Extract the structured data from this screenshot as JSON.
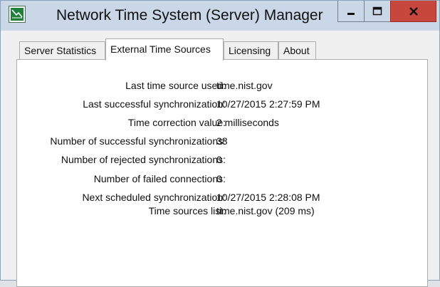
{
  "window": {
    "title": "Network Time System (Server) Manager",
    "icon": "app-window-icon",
    "controls": {
      "minimize_icon": "minimize-icon",
      "maximize_icon": "maximize-icon",
      "close_icon": "close-icon"
    },
    "colors": {
      "titlebar": "#c9d7e7",
      "close_button": "#c7473d"
    }
  },
  "tabs": [
    {
      "label": "Server Statistics"
    },
    {
      "label": "External Time Sources",
      "selected": true
    },
    {
      "label": "Licensing"
    },
    {
      "label": "About"
    }
  ],
  "stats": [
    {
      "label": "Last time source used:",
      "value": "time.nist.gov"
    },
    {
      "label": "Last successful synchronization:",
      "value": "10/27/2015 2:27:59 PM"
    },
    {
      "label": "Time correction value:",
      "value": "2 milliseconds"
    },
    {
      "label": "Number of successful synchronizations:",
      "value": "38"
    },
    {
      "label": "Number of rejected synchronizations:",
      "value": "0"
    },
    {
      "label": "Number of failed connections:",
      "value": "0"
    },
    {
      "label": "Next scheduled synchronization:",
      "value": "10/27/2015 2:28:08 PM"
    },
    {
      "label": "Time sources list:",
      "value": "time.nist.gov (209 ms)"
    }
  ]
}
